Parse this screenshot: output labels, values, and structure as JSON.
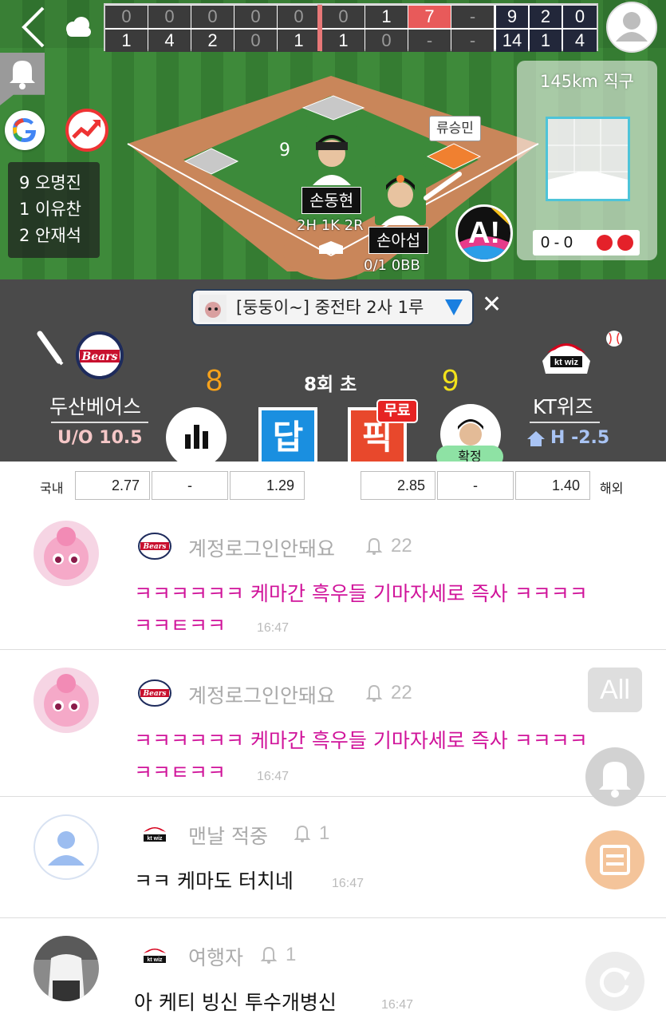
{
  "scoreboard": {
    "away_innings": [
      "0",
      "0",
      "0",
      "0",
      "0",
      "0",
      "1",
      "7",
      "-"
    ],
    "home_innings": [
      "1",
      "4",
      "2",
      "0",
      "1",
      "1",
      "0",
      "-",
      "-"
    ],
    "away_rhe": [
      "9",
      "2",
      "0"
    ],
    "home_rhe": [
      "14",
      "1",
      "4"
    ]
  },
  "lineup": [
    "9 오명진",
    "1 이유찬",
    "2 안재석"
  ],
  "field": {
    "position_number": "9",
    "batter_name": "손동현",
    "batter_stats": "2H 1K 2R",
    "pitcher_name": "손아섭",
    "pitcher_stats": "0/1 0BB",
    "runner_name": "류승민",
    "a_button_label": "A!"
  },
  "pitch": {
    "title": "145km 직구",
    "count": "0 - 0"
  },
  "ticker": {
    "text": "[둥둥이~] 중전타 2사 1루",
    "close": "✕"
  },
  "game": {
    "away_team": "두산베어스",
    "home_team": "KT위즈",
    "away_score": "8",
    "home_score": "9",
    "inning": "8회 초",
    "uo": "U/O 10.5",
    "handicap": "H -2.5",
    "dap_label": "답",
    "pick_label": "픽",
    "free_label": "무료",
    "confirm_label": "확정"
  },
  "odds": {
    "domestic_label": "국내",
    "overseas_label": "해외",
    "domestic": [
      "2.77",
      "-",
      "1.29"
    ],
    "overseas": [
      "2.85",
      "-",
      "1.40"
    ]
  },
  "chat": [
    {
      "user": "계정로그인안돼요",
      "count": "22",
      "line1": "ㅋㅋㅋㅋㅋㅋ 케마간 흑우들 기마자세로 즉사 ㅋㅋㅋㅋ",
      "line2": "ㅋㅋㅌㅋㅋ",
      "time": "16:47"
    },
    {
      "user": "계정로그인안돼요",
      "count": "22",
      "line1": "ㅋㅋㅋㅋㅋㅋ 케마간 흑우들 기마자세로 즉사 ㅋㅋㅋㅋ",
      "line2": "ㅋㅋㅌㅋㅋ",
      "time": "16:47"
    },
    {
      "user": "맨날  적중",
      "count": "1",
      "line1": "ㅋㅋ 케마도 터치네",
      "time": "16:47"
    },
    {
      "user": "여행자",
      "count": "1",
      "line1": "아 케티 빙신 투수개병신",
      "time": "16:47"
    }
  ],
  "floating": {
    "all_label": "All"
  },
  "colors": {
    "pink_msg": "#d0139a",
    "scoreboard_red": "#e85a5a",
    "away_score": "#f7a21b",
    "home_score": "#f2e21b"
  }
}
